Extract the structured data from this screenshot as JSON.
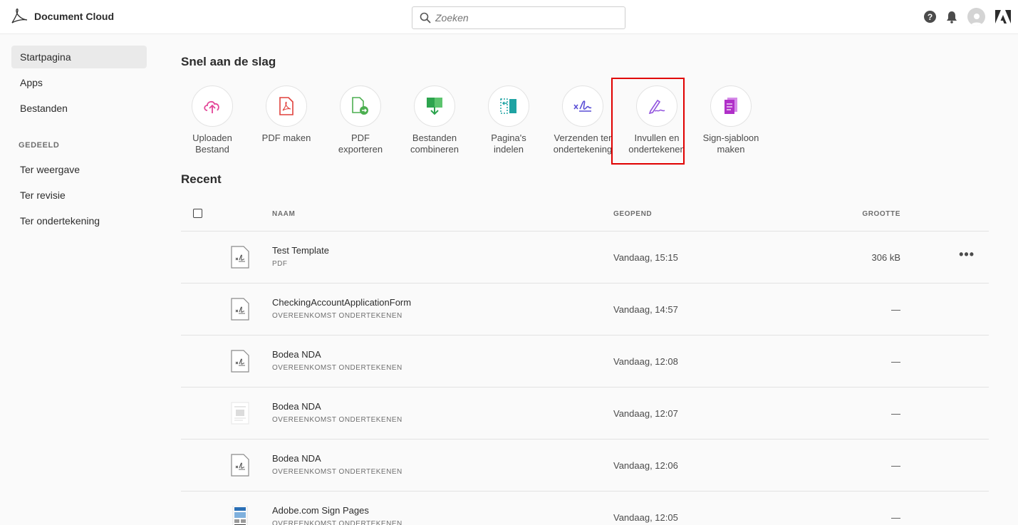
{
  "app": {
    "title": "Document Cloud"
  },
  "search": {
    "placeholder": "Zoeken"
  },
  "sidebar": {
    "items": [
      {
        "label": "Startpagina"
      },
      {
        "label": "Apps"
      },
      {
        "label": "Bestanden"
      }
    ],
    "shared_heading": "GEDEELD",
    "shared_items": [
      {
        "label": "Ter weergave"
      },
      {
        "label": "Ter revisie"
      },
      {
        "label": "Ter ondertekening"
      }
    ]
  },
  "quick_start": {
    "title": "Snel aan de slag",
    "tools": [
      {
        "label": "Uploaden Bestand",
        "icon": "upload-cloud-icon",
        "color": "#e34598"
      },
      {
        "label": "PDF maken",
        "icon": "create-pdf-icon",
        "color": "#e0413c"
      },
      {
        "label": "PDF exporteren",
        "icon": "export-pdf-icon",
        "color": "#4caf50"
      },
      {
        "label": "Bestanden combineren",
        "icon": "combine-files-icon",
        "color": "#2da44e"
      },
      {
        "label": "Pagina's indelen",
        "icon": "organize-pages-icon",
        "color": "#1fa3a3"
      },
      {
        "label": "Verzenden ter ondertekening",
        "icon": "send-for-signature-icon",
        "color": "#5a4fd6"
      },
      {
        "label": "Invullen en ondertekenen",
        "icon": "fill-and-sign-icon",
        "color": "#9254de"
      },
      {
        "label": "Sign-sjabloon maken",
        "icon": "sign-template-icon",
        "color": "#b030c8"
      }
    ]
  },
  "recent": {
    "title": "Recent",
    "columns": {
      "name": "NAAM",
      "opened": "GEOPEND",
      "size": "GROOTTE"
    },
    "rows": [
      {
        "name": "Test Template",
        "type": "PDF",
        "opened": "Vandaag, 15:15",
        "size": "306 kB",
        "more": "•••",
        "icon": "sign-document-icon"
      },
      {
        "name": "CheckingAccountApplicationForm",
        "type": "OVEREENKOMST ONDERTEKENEN",
        "opened": "Vandaag, 14:57",
        "size": "—",
        "icon": "sign-document-icon"
      },
      {
        "name": "Bodea NDA",
        "type": "OVEREENKOMST ONDERTEKENEN",
        "opened": "Vandaag, 12:08",
        "size": "—",
        "icon": "sign-document-icon"
      },
      {
        "name": "Bodea NDA",
        "type": "OVEREENKOMST ONDERTEKENEN",
        "opened": "Vandaag, 12:07",
        "size": "—",
        "icon": "document-thumbnail-icon"
      },
      {
        "name": "Bodea NDA",
        "type": "OVEREENKOMST ONDERTEKENEN",
        "opened": "Vandaag, 12:06",
        "size": "—",
        "icon": "sign-document-icon"
      },
      {
        "name": "Adobe.com Sign Pages",
        "type": "OVEREENKOMST ONDERTEKENEN",
        "opened": "Vandaag, 12:05",
        "size": "—",
        "icon": "web-page-thumbnail-icon"
      }
    ]
  }
}
